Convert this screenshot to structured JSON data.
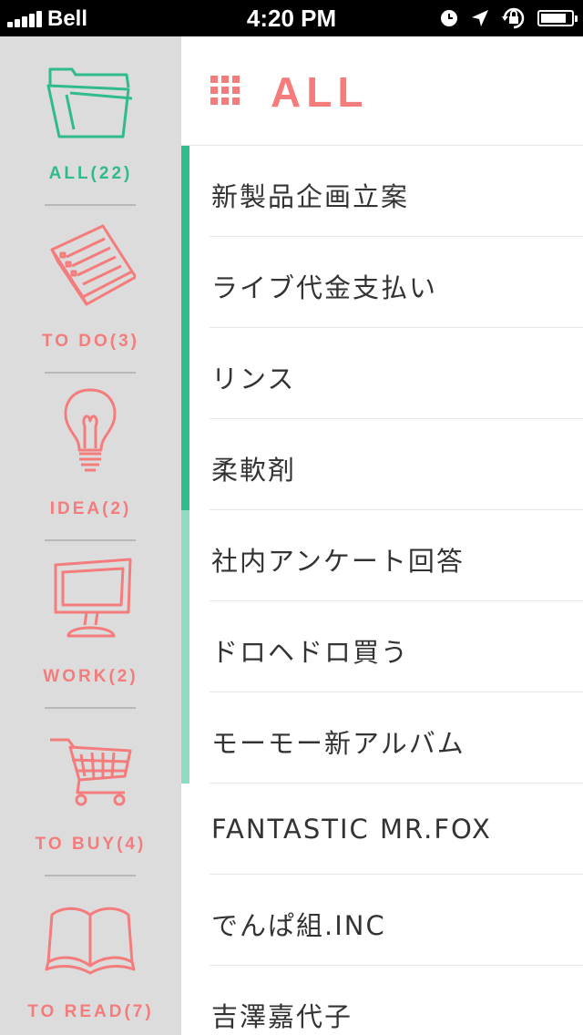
{
  "status_bar": {
    "carrier": "Bell",
    "time": "4:20 PM",
    "battery_level": 0.85
  },
  "colors": {
    "accent": "#f47c7c",
    "active": "#2fbb8c",
    "active_light": "#8fdcc2",
    "sidebar_bg": "#dcdcdc"
  },
  "sidebar": {
    "categories": [
      {
        "label": "ALL(22)",
        "icon": "folder-icon",
        "active": true
      },
      {
        "label": "TO DO(3)",
        "icon": "notepad-icon",
        "active": false
      },
      {
        "label": "IDEA(2)",
        "icon": "lightbulb-icon",
        "active": false
      },
      {
        "label": "WORK(2)",
        "icon": "computer-icon",
        "active": false
      },
      {
        "label": "TO BUY(4)",
        "icon": "shopping-cart-icon",
        "active": false
      },
      {
        "label": "TO READ(7)",
        "icon": "book-icon",
        "active": false
      }
    ]
  },
  "header": {
    "title": "ALL",
    "icon": "grid-icon"
  },
  "items": [
    "新製品企画立案",
    "ライブ代金支払い",
    "リンス",
    "柔軟剤",
    "社内アンケート回答",
    "ドロヘドロ買う",
    "モーモー新アルバム",
    "FANTASTIC MR.FOX",
    "でんぱ組.INC",
    "吉澤嘉代子"
  ]
}
